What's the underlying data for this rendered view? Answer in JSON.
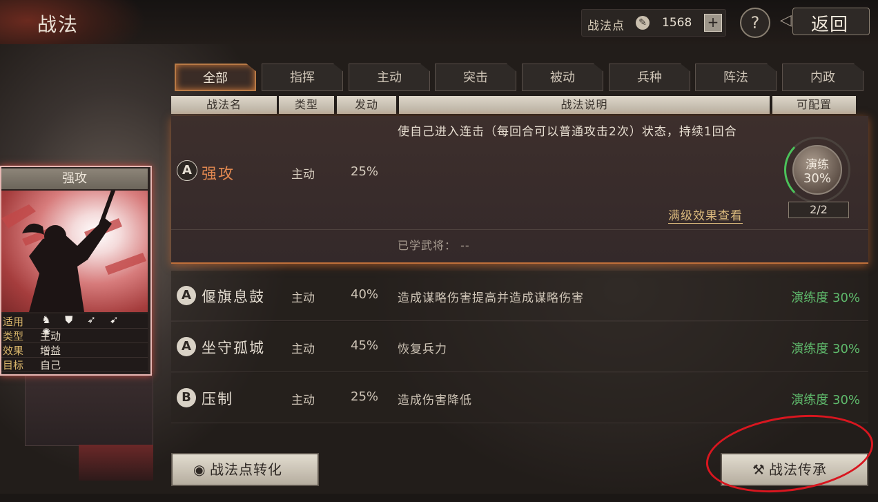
{
  "header": {
    "title": "战法",
    "points_label": "战法点",
    "points_value": "1568",
    "points_add": "+",
    "help": "?",
    "back_label": "返回"
  },
  "tabs": [
    {
      "label": "全部",
      "active": true
    },
    {
      "label": "指挥",
      "active": false
    },
    {
      "label": "主动",
      "active": false
    },
    {
      "label": "突击",
      "active": false
    },
    {
      "label": "被动",
      "active": false
    },
    {
      "label": "兵种",
      "active": false
    },
    {
      "label": "阵法",
      "active": false
    },
    {
      "label": "内政",
      "active": false
    }
  ],
  "columns": {
    "name": "战法名",
    "type": "类型",
    "rate": "发动",
    "desc": "战法说明",
    "config": "可配置"
  },
  "selected": {
    "grade": "A",
    "name": "强攻",
    "type": "主动",
    "rate": "25%",
    "desc": "使自己进入连击（每回合可以普通攻击2次）状态，持续1回合",
    "full_effect_link": "满级效果查看",
    "learned_label": "已学武将：",
    "learned_value": "--",
    "practice_label": "演练",
    "practice_value": "30%",
    "practice_count": "2/2"
  },
  "rows": [
    {
      "grade": "A",
      "name": "偃旗息鼓",
      "type": "主动",
      "rate": "40%",
      "desc": "造成谋略伤害提高并造成谋略伤害",
      "proficiency": "演练度 30%"
    },
    {
      "grade": "A",
      "name": "坐守孤城",
      "type": "主动",
      "rate": "45%",
      "desc": "恢复兵力",
      "proficiency": "演练度 30%"
    },
    {
      "grade": "B",
      "name": "压制",
      "type": "主动",
      "rate": "25%",
      "desc": "造成伤害降低",
      "proficiency": "演练度 30%"
    }
  ],
  "card": {
    "title": "强攻",
    "stats": [
      {
        "key": "适用",
        "value": ""
      },
      {
        "key": "类型",
        "value": "主动"
      },
      {
        "key": "效果",
        "value": "增益"
      },
      {
        "key": "目标",
        "value": "自己"
      }
    ],
    "unit_icons": [
      "cavalry-icon",
      "shield-icon",
      "bow-icon",
      "spear-icon",
      "wheel-icon"
    ]
  },
  "buttons": {
    "convert": "战法点转化",
    "inherit": "战法传承"
  },
  "colors": {
    "accent_orange": "#c0703a",
    "proficiency_green": "#5fba6c",
    "annotation_red": "#d8161f"
  }
}
